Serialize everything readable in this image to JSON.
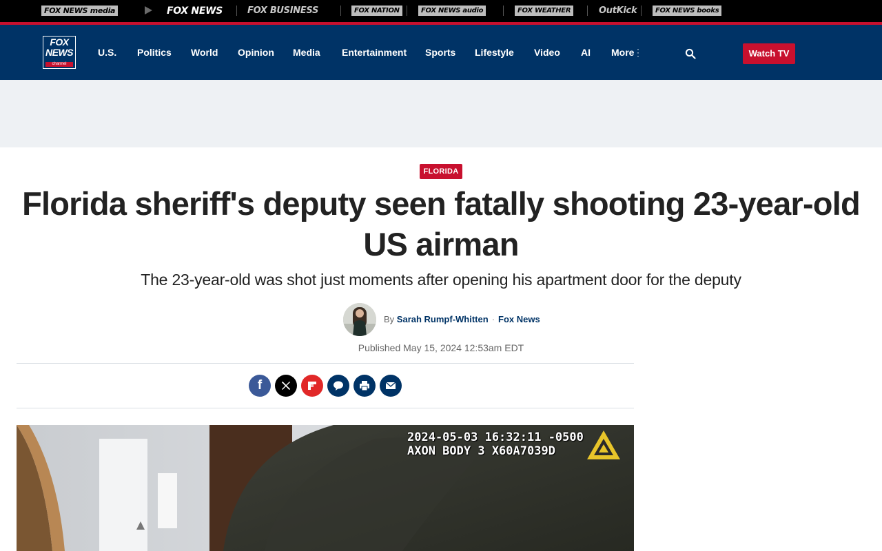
{
  "network_bar": {
    "items": [
      "FOX NEWS media",
      "FOX NEWS",
      "FOX BUSINESS",
      "FOX NATION",
      "FOX NEWS audio",
      "FOX WEATHER",
      "OutKick",
      "FOX NEWS books"
    ]
  },
  "logo": {
    "line1": "FOX",
    "line2": "NEWS",
    "line3": "channel"
  },
  "nav": {
    "links": [
      "U.S.",
      "Politics",
      "World",
      "Opinion",
      "Media",
      "Entertainment",
      "Sports",
      "Lifestyle",
      "Video",
      "AI",
      "More"
    ],
    "watch_label": "Watch TV"
  },
  "article": {
    "category": "FLORIDA",
    "headline": "Florida sheriff's deputy seen fatally shooting 23-year-old US airman",
    "dek": "The 23-year-old was shot just moments after opening his apartment door for the deputy",
    "byline": {
      "prefix": "By",
      "author": "Sarah Rumpf-Whitten",
      "separator": "·",
      "source": "Fox News"
    },
    "published": "Published May 15, 2024 12:53am EDT"
  },
  "share_icons": [
    "facebook-icon",
    "x-icon",
    "flipboard-icon",
    "comments-icon",
    "print-icon",
    "email-icon"
  ],
  "video_frame": {
    "stamp_line1": "2024-05-03 16:32:11 -0500",
    "stamp_line2": "AXON BODY 3 X60A7039D"
  },
  "colors": {
    "brand_navy": "#003366",
    "brand_red": "#c8102e"
  }
}
